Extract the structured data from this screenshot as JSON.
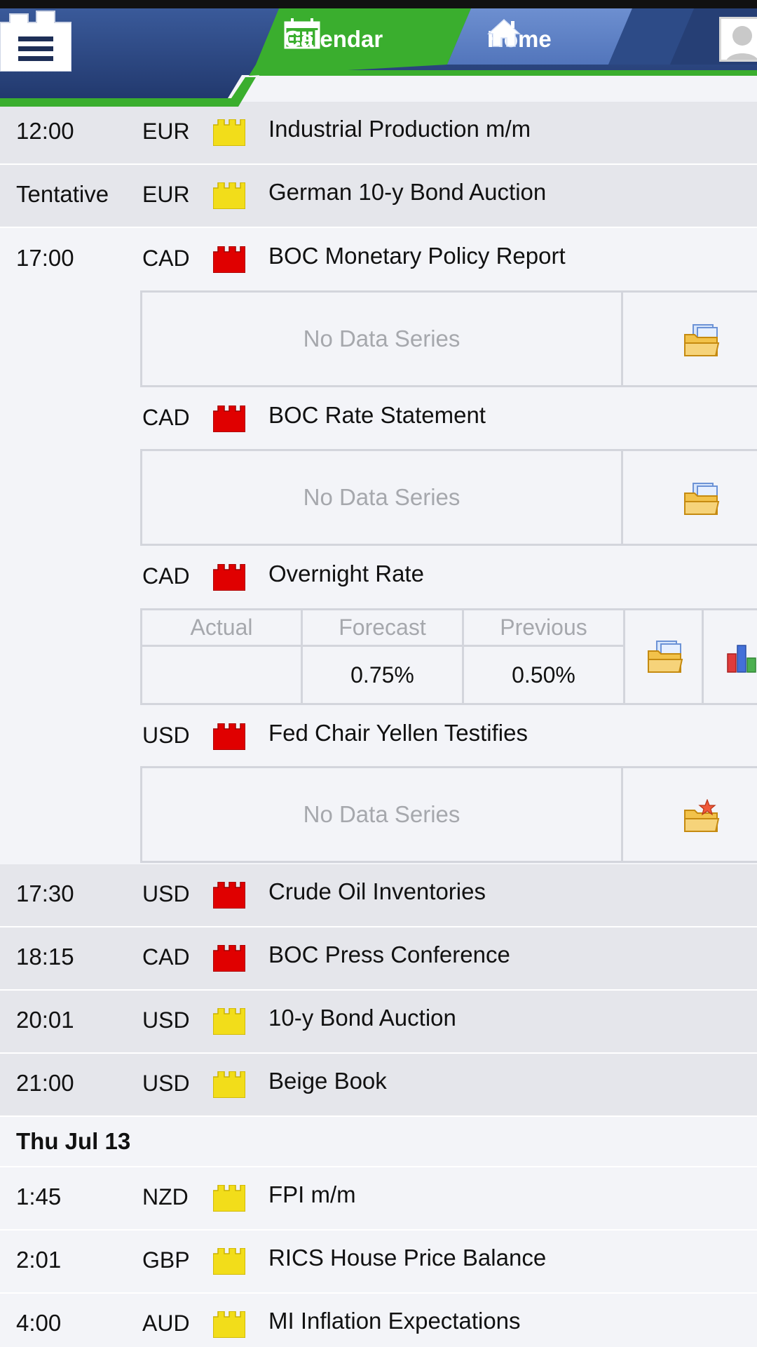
{
  "header": {
    "menu_icon": "hamburger-icon",
    "tabs": [
      {
        "label": "Calendar",
        "icon": "calendar-icon",
        "active": true
      },
      {
        "label": "Home",
        "icon": "home-icon",
        "active": false
      }
    ],
    "avatar_icon": "user-avatar-icon"
  },
  "colors": {
    "header_navy": "#2c4a86",
    "active_tab_green": "#3aae2e",
    "impact_high": "#e00000",
    "impact_medium": "#f2dd1a"
  },
  "events": [
    {
      "time": "12:00",
      "currency": "EUR",
      "impact": "medium",
      "title": "Industrial Production m/m"
    },
    {
      "time": "Tentative",
      "currency": "EUR",
      "impact": "medium",
      "title": "German 10-y Bond Auction"
    },
    {
      "time": "17:00",
      "currency": "CAD",
      "impact": "high",
      "title": "BOC Monetary Policy Report",
      "detail": "No Data Series"
    },
    {
      "time": "",
      "currency": "CAD",
      "impact": "high",
      "title": "BOC Rate Statement",
      "detail": "No Data Series"
    },
    {
      "time": "",
      "currency": "CAD",
      "impact": "high",
      "title": "Overnight Rate",
      "table": {
        "headers": [
          "Actual",
          "Forecast",
          "Previous"
        ],
        "values": [
          "",
          "0.75%",
          "0.50%"
        ]
      }
    },
    {
      "time": "",
      "currency": "USD",
      "impact": "high",
      "title": "Fed Chair Yellen Testifies",
      "detail": "No Data Series"
    },
    {
      "time": "17:30",
      "currency": "USD",
      "impact": "high",
      "title": "Crude Oil Inventories"
    },
    {
      "time": "18:15",
      "currency": "CAD",
      "impact": "high",
      "title": "BOC Press Conference"
    },
    {
      "time": "20:01",
      "currency": "USD",
      "impact": "medium",
      "title": "10-y Bond Auction"
    },
    {
      "time": "21:00",
      "currency": "USD",
      "impact": "medium",
      "title": "Beige Book"
    }
  ],
  "day_header": "Thu Jul 13",
  "next_day_events": [
    {
      "time": "1:45",
      "currency": "NZD",
      "impact": "medium",
      "title": "FPI m/m"
    },
    {
      "time": "2:01",
      "currency": "GBP",
      "impact": "medium",
      "title": "RICS House Price Balance"
    },
    {
      "time": "4:00",
      "currency": "AUD",
      "impact": "medium",
      "title": "MI Inflation Expectations"
    }
  ]
}
